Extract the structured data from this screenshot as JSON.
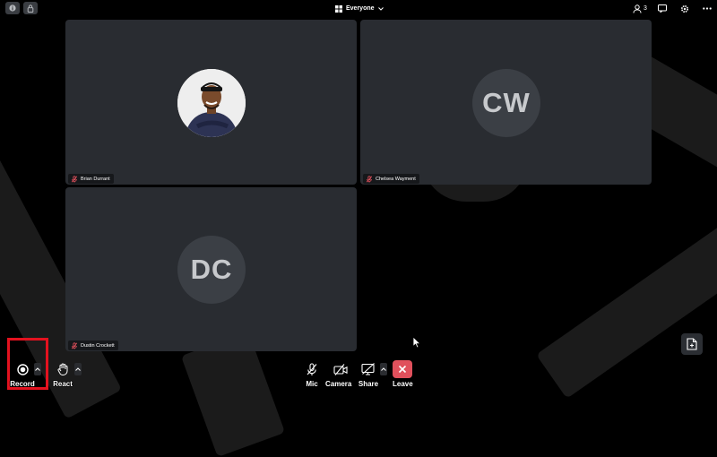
{
  "topbar": {
    "view_label": "Everyone",
    "participant_count": "3",
    "icons": [
      "info-icon",
      "lock-icon",
      "grid-icon",
      "chevron-down-icon",
      "participants-icon",
      "chat-icon",
      "settings-icon",
      "more-icon"
    ]
  },
  "participants": [
    {
      "name": "Brian Durrant",
      "initials": "",
      "has_photo": true,
      "mic_muted": true
    },
    {
      "name": "Chelsea Wayment",
      "initials": "CW",
      "has_photo": false,
      "mic_muted": true
    },
    {
      "name": "Dustin Crockett",
      "initials": "DC",
      "has_photo": false,
      "mic_muted": true
    }
  ],
  "controls": {
    "record": "Record",
    "react": "React",
    "mic": "Mic",
    "camera": "Camera",
    "share": "Share",
    "leave": "Leave"
  },
  "colors": {
    "background": "#000000",
    "tile": "#292c31",
    "leave": "#e0505c",
    "highlight": "#e3121f",
    "muted": "#e0505c"
  }
}
